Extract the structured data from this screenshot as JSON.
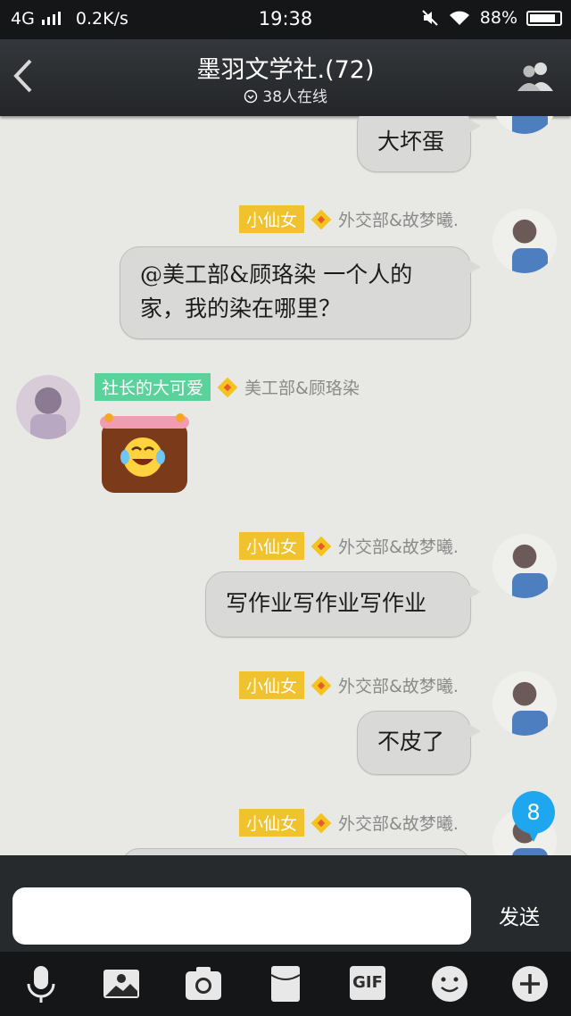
{
  "status_bar": {
    "network": "4G",
    "speed": "0.2K/s",
    "time": "19:38",
    "battery": "88%",
    "battery_level": 0.88
  },
  "header": {
    "title": "墨羽文学社.(72)",
    "online": "38人在线"
  },
  "messages": [
    {
      "side": "right",
      "text": "大坏蛋"
    },
    {
      "side": "right",
      "badge": "小仙女",
      "sender": "外交部&故梦曦.",
      "text_lines": [
        "@美工部&顾珞染 一个人的",
        "家，我的染在哪里？"
      ]
    },
    {
      "side": "left",
      "badge": "社长的大可爱",
      "sender": "美工部&顾珞染",
      "sticker": "laughing-crying-emoji"
    },
    {
      "side": "right",
      "badge": "小仙女",
      "sender": "外交部&故梦曦.",
      "text": "写作业写作业写作业"
    },
    {
      "side": "right",
      "badge": "小仙女",
      "sender": "外交部&故梦曦.",
      "text": "不皮了"
    },
    {
      "side": "right",
      "badge": "小仙女",
      "sender": "外交部&故梦曦."
    }
  ],
  "unread_count": "8",
  "input": {
    "placeholder": "",
    "send_label": "发送"
  },
  "toolbar": {
    "gif_label": "GIF",
    "icons": [
      "microphone-icon",
      "picture-icon",
      "camera-icon",
      "red-packet-icon",
      "gif-icon",
      "emoji-icon",
      "plus-icon"
    ]
  },
  "colors": {
    "badge_yellow": "#f0c22e",
    "badge_green": "#5bd19c",
    "unread_blue": "#1ea7ee",
    "bubble": "#d9d9d7"
  }
}
